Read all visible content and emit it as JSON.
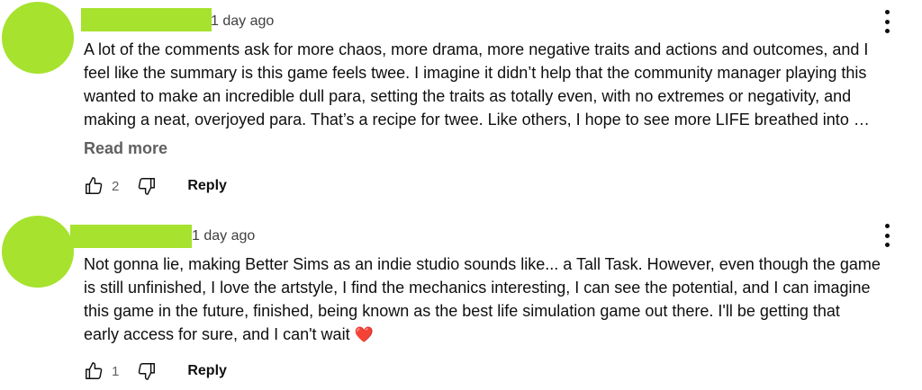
{
  "comments": [
    {
      "timestamp": "1 day ago",
      "body_lines": [
        "A lot of the comments ask for more chaos, more drama, more negative traits and actions and outcomes, and I",
        "feel like the summary is this game feels twee. I imagine it didn’t help that the community manager playing this",
        "wanted to make an incredible dull para, setting the traits as totally even, with no extremes or negativity, and",
        "making a neat, overjoyed para. That’s a recipe for twee. Like others, I hope to see more LIFE breathed into …"
      ],
      "read_more_label": "Read more",
      "like_count": "2",
      "reply_label": "Reply"
    },
    {
      "timestamp": "1 day ago",
      "body_lines": [
        "Not gonna lie, making Better Sims as an indie studio sounds like... a Tall Task. However, even though the game",
        "is still unfinished, I love the artstyle, I find the mechanics interesting, I can see the potential, and I can imagine",
        "this game in the future, finished, being known as the best life simulation game out there. I'll be getting that",
        "early access for sure, and I can't wait"
      ],
      "emoji": "❤️",
      "like_count": "1",
      "reply_label": "Reply"
    }
  ],
  "icons": {
    "like": "thumbs-up-icon",
    "dislike": "thumbs-down-icon",
    "menu": "more-vertical-icon"
  },
  "colors": {
    "avatar_redaction": "#a6e22e",
    "heart": "#e0282e"
  }
}
